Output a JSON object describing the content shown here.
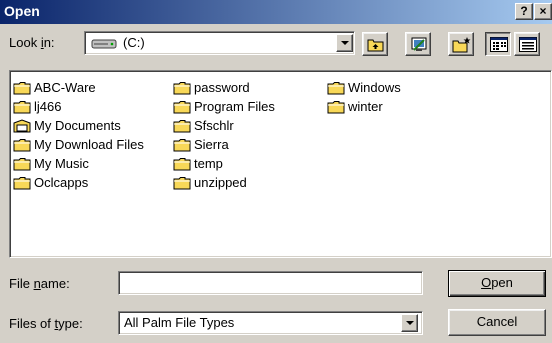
{
  "window": {
    "title": "Open",
    "help_glyph": "?",
    "close_glyph": "×"
  },
  "look_in": {
    "label_pre": "Look ",
    "label_key": "i",
    "label_post": "n:",
    "value": "(C:)",
    "icon": "drive-icon"
  },
  "toolbar": {
    "up_icon": "up-folder-icon",
    "desktop_icon": "desktop-icon",
    "new_folder_icon": "new-folder-icon",
    "list_view_icon": "list-view-icon",
    "details_view_icon": "details-view-icon"
  },
  "files": {
    "col1": [
      "ABC-Ware",
      "lj466",
      "My Documents",
      "My Download Files",
      "My Music",
      "Oclcapps"
    ],
    "col2": [
      "password",
      "Program Files",
      "Sfschlr",
      "Sierra",
      "temp",
      "unzipped"
    ],
    "col3": [
      "Windows",
      "winter"
    ]
  },
  "file_name": {
    "label_pre": "File ",
    "label_key": "n",
    "label_post": "ame:",
    "value": ""
  },
  "file_type": {
    "label_pre": "Files of ",
    "label_key": "t",
    "label_post": "ype:",
    "value": "All Palm File Types"
  },
  "buttons": {
    "open_key": "O",
    "open_rest": "pen",
    "cancel": "Cancel"
  },
  "colors": {
    "title_start": "#0a246a",
    "title_end": "#a6caf0",
    "folder": "#f8d858",
    "face": "#d4d0c8"
  }
}
